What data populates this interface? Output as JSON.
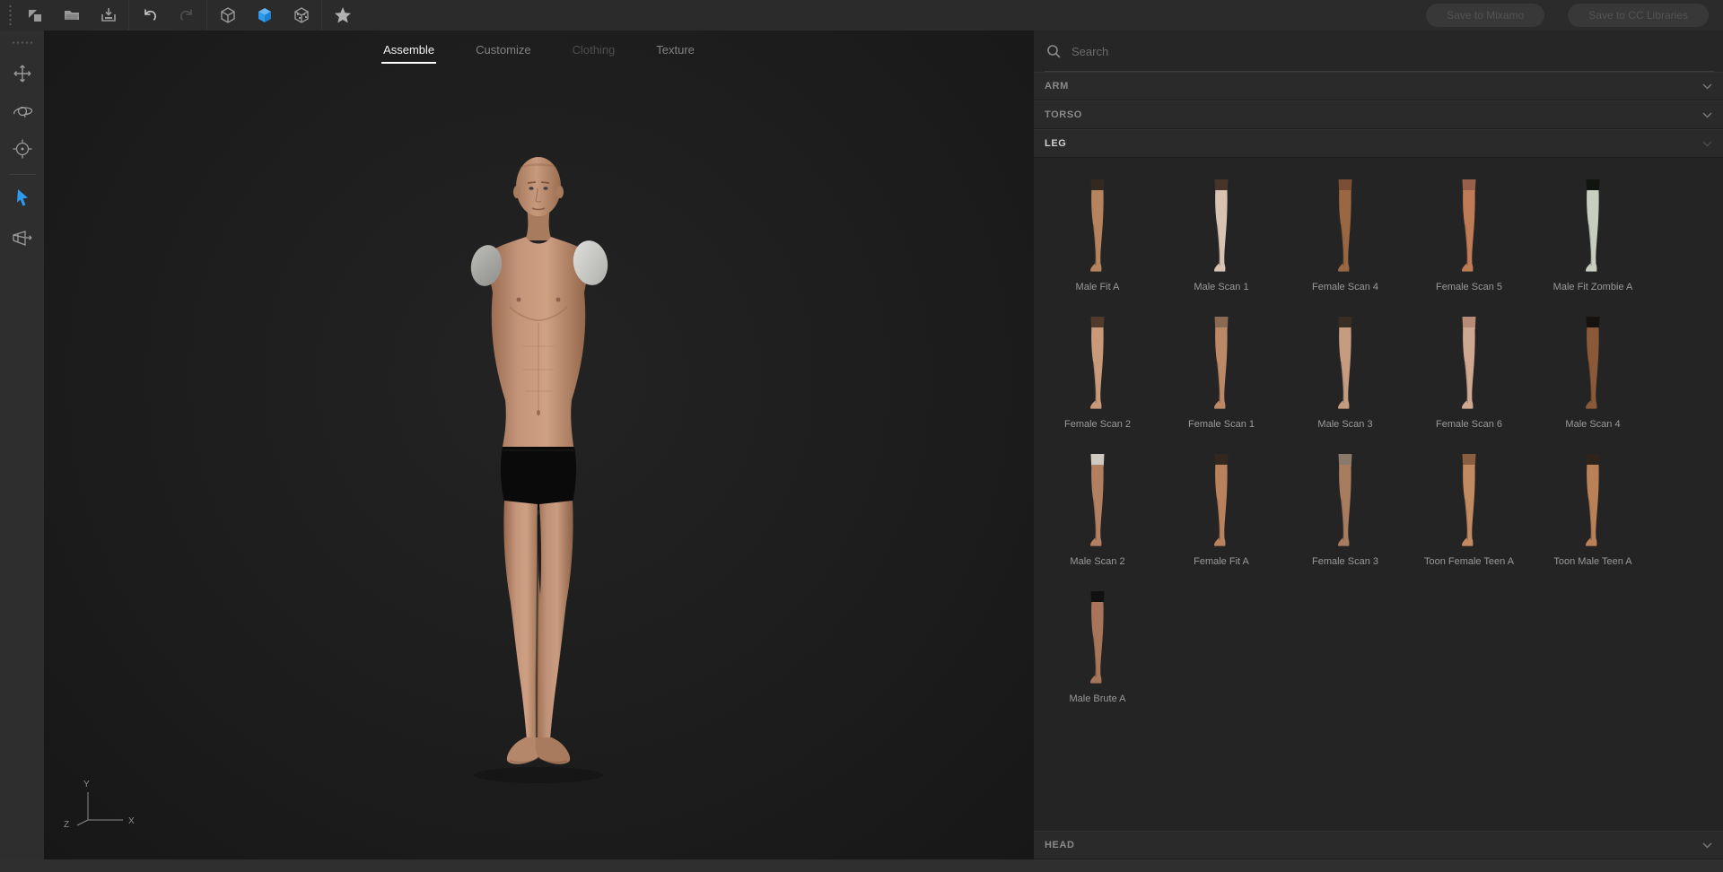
{
  "toolbar": {
    "buttons": {
      "save_to_mixamo": "Save to Mixamo",
      "save_to_cc_libraries": "Save to CC Libraries"
    }
  },
  "tabs": [
    {
      "label": "Assemble",
      "state": "active"
    },
    {
      "label": "Customize",
      "state": "normal"
    },
    {
      "label": "Clothing",
      "state": "disabled"
    },
    {
      "label": "Texture",
      "state": "normal"
    }
  ],
  "search": {
    "placeholder": "Search"
  },
  "sections": {
    "arm": "ARM",
    "torso": "TORSO",
    "leg": "LEG",
    "head": "HEAD"
  },
  "leg_items": [
    {
      "label": "Male Fit A",
      "skin": "#b5845e",
      "cap": "#33291f"
    },
    {
      "label": "Male Scan 1",
      "skin": "#d8c3b3",
      "cap": "#483529"
    },
    {
      "label": "Female Scan 4",
      "skin": "#9a6743",
      "cap": "#7a4f35"
    },
    {
      "label": "Female Scan 5",
      "skin": "#bf7b56",
      "cap": "#96604a"
    },
    {
      "label": "Male Fit Zombie A",
      "skin": "#c8cebf",
      "cap": "#121410"
    },
    {
      "label": "Female Scan 2",
      "skin": "#c89a7a",
      "cap": "#513a2c"
    },
    {
      "label": "Female Scan 1",
      "skin": "#bb8966",
      "cap": "#8a6a52"
    },
    {
      "label": "Male Scan 3",
      "skin": "#c69c81",
      "cap": "#3a2d22"
    },
    {
      "label": "Female Scan 6",
      "skin": "#cfa891",
      "cap": "#b68c76"
    },
    {
      "label": "Male Scan 4",
      "skin": "#8a5a38",
      "cap": "#16120f"
    },
    {
      "label": "Male Scan 2",
      "skin": "#b08060",
      "cap": "#cfc9c1"
    },
    {
      "label": "Female Fit A",
      "skin": "#b9825c",
      "cap": "#33281f"
    },
    {
      "label": "Female Scan 3",
      "skin": "#a87c5e",
      "cap": "#8a7a6c"
    },
    {
      "label": "Toon Female Teen A",
      "skin": "#c28a60",
      "cap": "#8a5e40"
    },
    {
      "label": "Toon Male Teen A",
      "skin": "#ba8156",
      "cap": "#2f241b"
    },
    {
      "label": "Male Brute A",
      "skin": "#a7765a",
      "cap": "#101010"
    }
  ],
  "axis_gizmo": {
    "x": "X",
    "y": "Y",
    "z": "Z"
  },
  "colors": {
    "accent": "#2f9bf0"
  },
  "character": {
    "skin": "#c4957a",
    "skin_shadow": "#96684c",
    "briefs": "#0a0a0a",
    "shoulder_cap_left": "#bcbcb8",
    "shoulder_cap_right": "#e0e0dd"
  }
}
